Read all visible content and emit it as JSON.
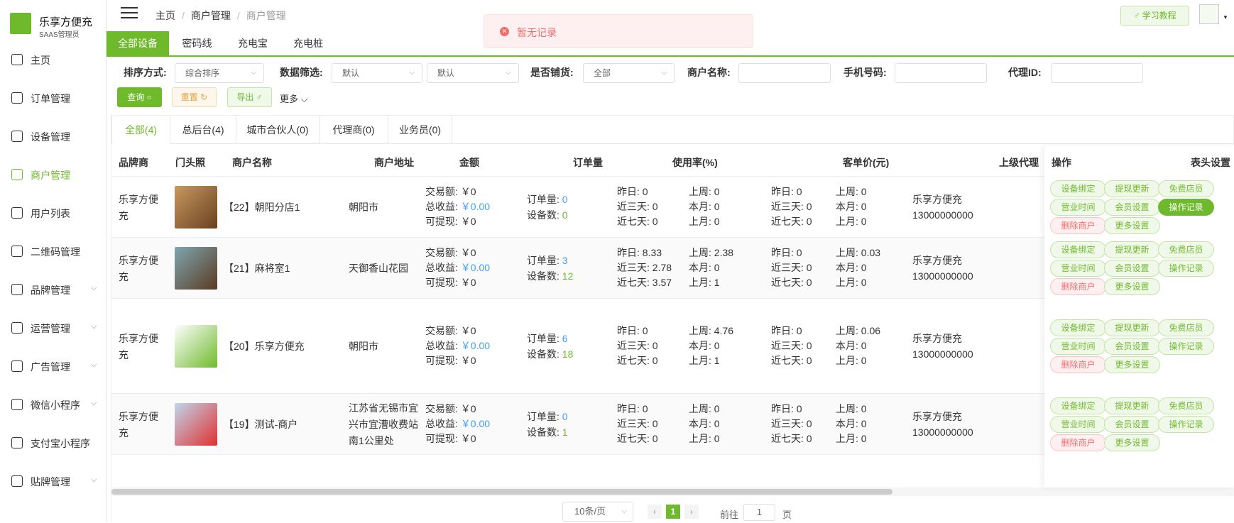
{
  "app": {
    "name": "乐享方便充",
    "sub": "SAAS管理员"
  },
  "sidebar": {
    "items": [
      {
        "label": "主页"
      },
      {
        "label": "订单管理"
      },
      {
        "label": "设备管理"
      },
      {
        "label": "商户管理"
      },
      {
        "label": "用户列表"
      },
      {
        "label": "二维码管理"
      },
      {
        "label": "品牌管理"
      },
      {
        "label": "运营管理"
      },
      {
        "label": "广告管理"
      },
      {
        "label": "微信小程序"
      },
      {
        "label": "支付宝小程序"
      },
      {
        "label": "贴牌管理"
      }
    ]
  },
  "breadcrumb": {
    "home": "主页",
    "parent": "商户管理",
    "current": "商户管理"
  },
  "header": {
    "tutorial": "♂ 学习教程"
  },
  "toast": {
    "message": "暂无记录"
  },
  "tabs": [
    "全部设备",
    "密码线",
    "充电宝",
    "充电桩"
  ],
  "filters": {
    "sort_label": "排序方式:",
    "sort_value": "综合排序",
    "data_label": "数据筛选:",
    "data_value1": "默认",
    "data_value2": "默认",
    "stock_label": "是否铺货:",
    "stock_value": "全部",
    "merchant_label": "商户名称:",
    "phone_label": "手机号码:",
    "agent_label": "代理ID:",
    "query": "查询 ○",
    "reset": "重置 ↻",
    "export": "导出 ♂",
    "more": "更多"
  },
  "subtabs": [
    "全部(4)",
    "总后台(4)",
    "城市合伙人(0)",
    "代理商(0)",
    "业务员(0)"
  ],
  "table": {
    "headers": {
      "brand": "品牌商",
      "photo": "门头照",
      "name": "商户名称",
      "addr": "商户地址",
      "amount": "金额",
      "orders": "订单量",
      "usage": "使用率(%)",
      "avg": "客单价(元)",
      "parent": "上级代理",
      "ops": "操作",
      "settings": "表头设置"
    },
    "rows": [
      {
        "brand": "乐享方便充",
        "name": "【22】朝阳分店1",
        "addr": "朝阳市",
        "trade": "交易额: ￥0",
        "income_lbl": "总收益: ",
        "income": "￥0.00",
        "withdraw": "可提现: ￥0",
        "orders_lbl": "订单量: ",
        "orders": "0",
        "devices_lbl": "设备数: ",
        "devices": "0",
        "u1": "昨日: 0",
        "u2": "近三天: 0",
        "u3": "近七天: 0",
        "u4": "上周: 0",
        "u5": "本月: 0",
        "u6": "上月: 0",
        "a1": "昨日: 0",
        "a2": "近三天: 0",
        "a3": "近七天: 0",
        "a4": "上周: 0",
        "a5": "本月: 0",
        "a6": "上月: 0",
        "parent1": "乐享方便充",
        "parent2": "13000000000"
      },
      {
        "brand": "乐享方便充",
        "name": "【21】麻将室1",
        "addr": "天御香山花园",
        "trade": "交易额: ￥0",
        "income_lbl": "总收益: ",
        "income": "￥0.00",
        "withdraw": "可提现: ￥0",
        "orders_lbl": "订单量: ",
        "orders": "3",
        "devices_lbl": "设备数: ",
        "devices": "12",
        "u1": "昨日: 8.33",
        "u2": "近三天: 2.78",
        "u3": "近七天: 3.57",
        "u4": "上周: 2.38",
        "u5": "本月: 0",
        "u6": "上月: 1",
        "a1": "昨日: 0",
        "a2": "近三天: 0",
        "a3": "近七天: 0",
        "a4": "上周: 0.03",
        "a5": "本月: 0",
        "a6": "上月: 0",
        "parent1": "乐享方便充",
        "parent2": "13000000000"
      },
      {
        "brand": "乐享方便充",
        "name": "【20】乐享方便充",
        "addr": "朝阳市",
        "trade": "交易额: ￥0",
        "income_lbl": "总收益: ",
        "income": "￥0.00",
        "withdraw": "可提现: ￥0",
        "orders_lbl": "订单量: ",
        "orders": "6",
        "devices_lbl": "设备数: ",
        "devices": "18",
        "u1": "昨日: 0",
        "u2": "近三天: 0",
        "u3": "近七天: 0",
        "u4": "上周: 4.76",
        "u5": "本月: 0",
        "u6": "上月: 1",
        "a1": "昨日: 0",
        "a2": "近三天: 0",
        "a3": "近七天: 0",
        "a4": "上周: 0.06",
        "a5": "本月: 0",
        "a6": "上月: 0",
        "parent1": "乐享方便充",
        "parent2": "13000000000"
      },
      {
        "brand": "乐享方便充",
        "name": "【19】测试-商户",
        "addr": "江苏省无锡市宜兴市宜漕收费站南1公里处",
        "trade": "交易额: ￥0",
        "income_lbl": "总收益: ",
        "income": "￥0.00",
        "withdraw": "可提现: ￥0",
        "orders_lbl": "订单量: ",
        "orders": "0",
        "devices_lbl": "设备数: ",
        "devices": "1",
        "u1": "昨日: 0",
        "u2": "近三天: 0",
        "u3": "近七天: 0",
        "u4": "上周: 0",
        "u5": "本月: 0",
        "u6": "上月: 0",
        "a1": "昨日: 0",
        "a2": "近三天: 0",
        "a3": "近七天: 0",
        "a4": "上周: 0",
        "a5": "本月: 0",
        "a6": "上月: 0",
        "parent1": "乐享方便充",
        "parent2": "13000000000"
      }
    ],
    "ops": [
      "设备绑定",
      "提现更新",
      "免费店员",
      "营业时间",
      "会员设置",
      "操作记录",
      "删除商户",
      "更多设置"
    ]
  },
  "pager": {
    "size": "10条/页",
    "page": "1",
    "goto": "前往",
    "goto_value": "1",
    "page_unit": "页"
  }
}
